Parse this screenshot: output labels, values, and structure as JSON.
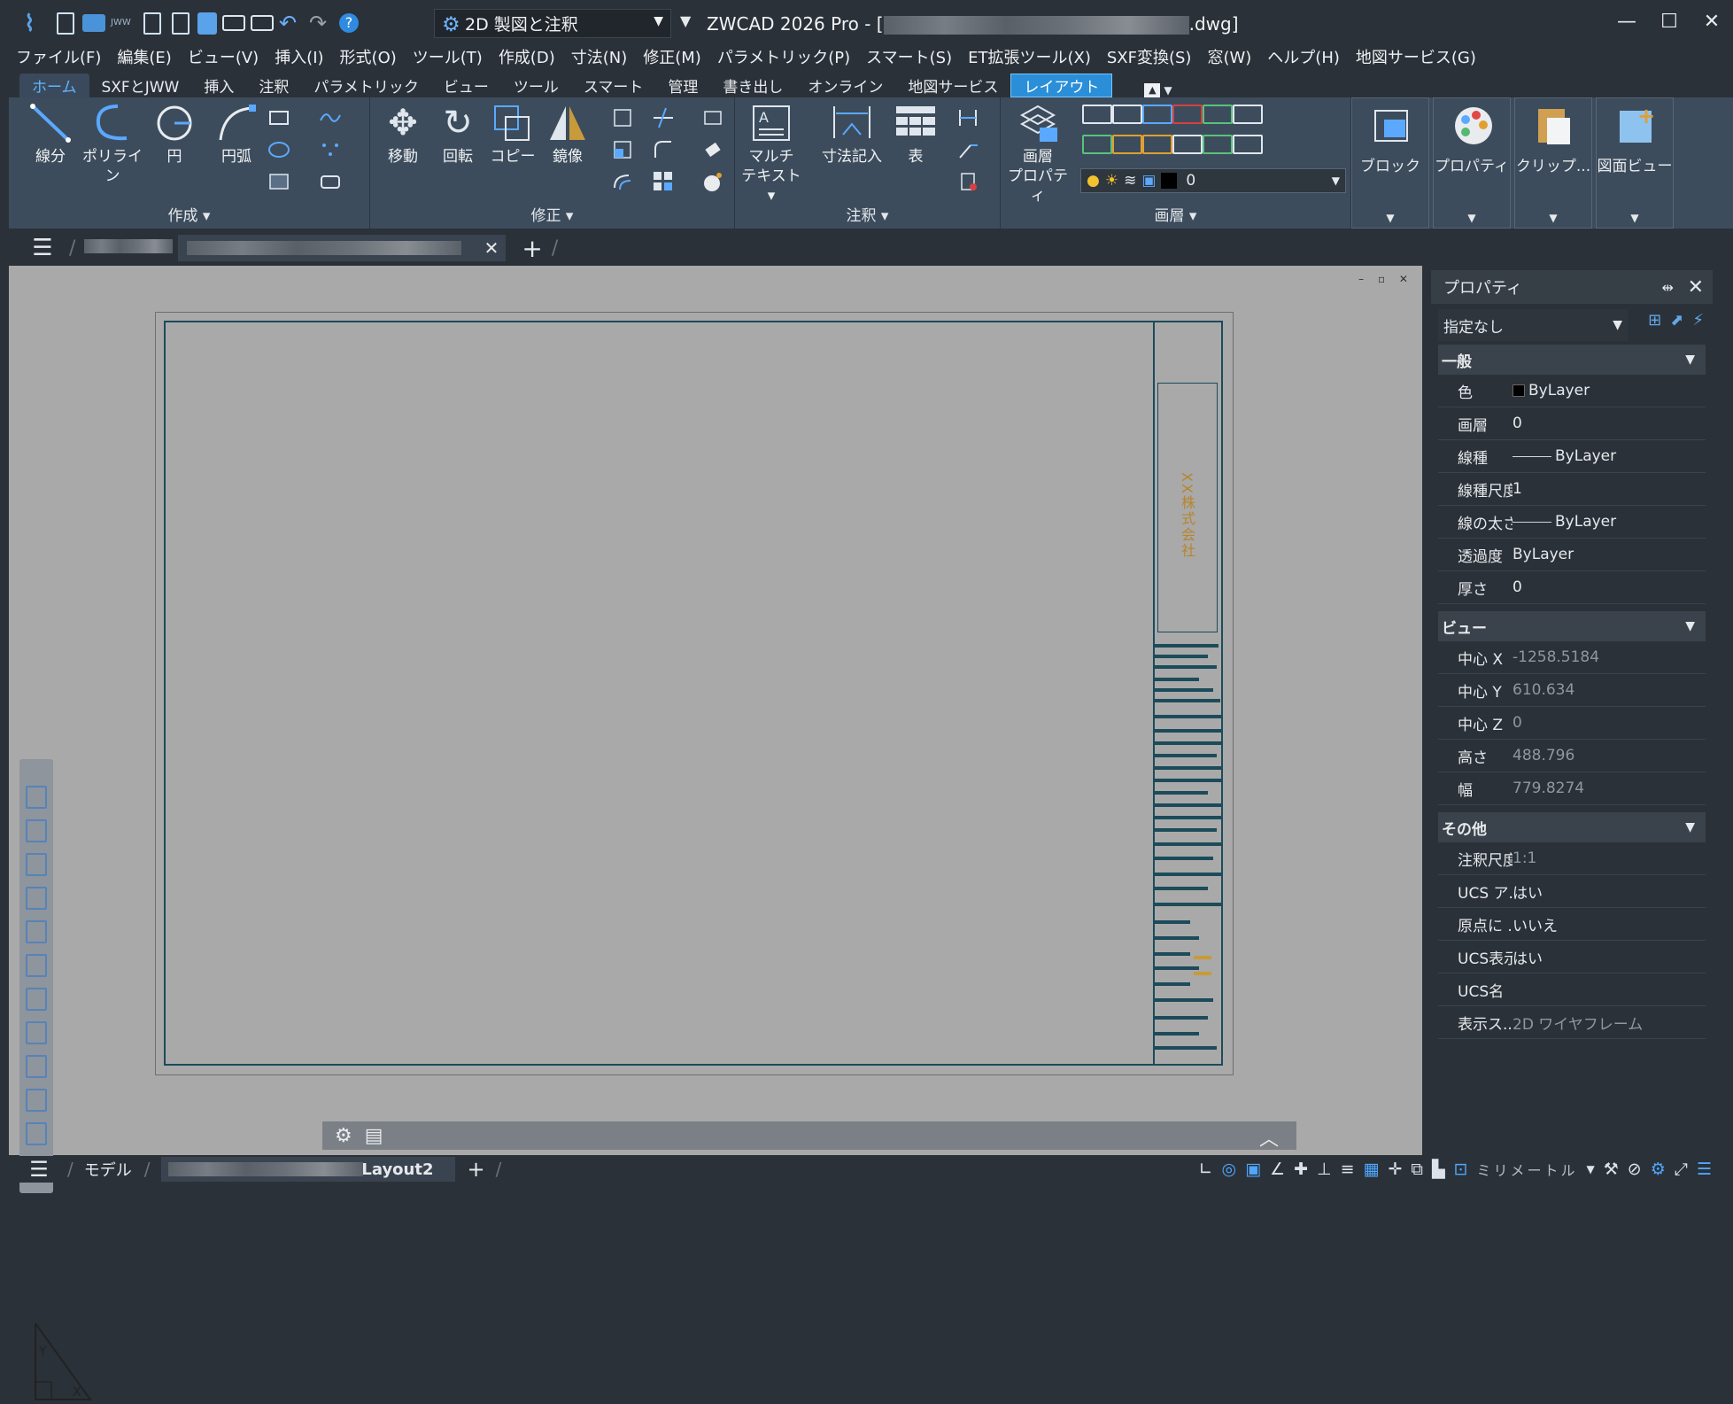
{
  "titlebar": {
    "workspace": "2D 製図と注釈",
    "app_name_prefix": "ZWCAD 2026 Pro - [",
    "file_suffix": ".dwg]",
    "win_min": "—",
    "win_max": "☐",
    "win_close": "✕"
  },
  "menu": [
    "ファイル(F)",
    "編集(E)",
    "ビュー(V)",
    "挿入(I)",
    "形式(O)",
    "ツール(T)",
    "作成(D)",
    "寸法(N)",
    "修正(M)",
    "パラメトリック(P)",
    "スマート(S)",
    "ET拡張ツール(X)",
    "SXF変換(S)",
    "窓(W)",
    "ヘルプ(H)",
    "地図サービス(G)"
  ],
  "tabs": [
    "ホーム",
    "SXFとJWW",
    "挿入",
    "注釈",
    "パラメトリック",
    "ビュー",
    "ツール",
    "スマート",
    "管理",
    "書き出し",
    "オンライン",
    "地図サービス",
    "レイアウト"
  ],
  "ribbon": {
    "create": {
      "label": "作成",
      "line": "線分",
      "polyline": "ポリライン",
      "circle": "円",
      "arc": "円弧"
    },
    "modify": {
      "label": "修正",
      "move": "移動",
      "rotate": "回転",
      "copy": "コピー",
      "mirror": "鏡像"
    },
    "annot": {
      "label": "注釈",
      "mtext1": "マルチ",
      "mtext2": "テキスト",
      "dim": "寸法記入",
      "table": "表"
    },
    "layer": {
      "label": "画層",
      "prop1": "画層",
      "prop2": "プロパティ",
      "current": "0"
    },
    "block": "ブロック",
    "properties": "プロパティ",
    "clipboard": "クリップ...",
    "viewsheet": "図面ビュー"
  },
  "canvas": {
    "company": "XX株式会社",
    "vpctrl": "– ▫ ✕"
  },
  "props": {
    "title": "プロパティ",
    "selection": "指定なし",
    "general": {
      "header": "一般",
      "rows": [
        {
          "k": "色",
          "v": "ByLayer"
        },
        {
          "k": "画層",
          "v": "0"
        },
        {
          "k": "線種",
          "v": "ByLayer"
        },
        {
          "k": "線種尺度",
          "v": "1"
        },
        {
          "k": "線の太さ",
          "v": "ByLayer"
        },
        {
          "k": "透過度",
          "v": "ByLayer"
        },
        {
          "k": "厚さ",
          "v": "0"
        }
      ]
    },
    "view": {
      "header": "ビュー",
      "rows": [
        {
          "k": "中心 X",
          "v": "-1258.5184"
        },
        {
          "k": "中心 Y",
          "v": "610.634"
        },
        {
          "k": "中心 Z",
          "v": "0"
        },
        {
          "k": "高さ",
          "v": "488.796"
        },
        {
          "k": "幅",
          "v": "779.8274"
        }
      ]
    },
    "other": {
      "header": "その他",
      "rows": [
        {
          "k": "注釈尺度",
          "v": "1:1"
        },
        {
          "k": "UCS ア...",
          "v": "はい"
        },
        {
          "k": "原点に ...",
          "v": "いいえ"
        },
        {
          "k": "UCS表示",
          "v": "はい"
        },
        {
          "k": "UCS名",
          "v": ""
        },
        {
          "k": "表示ス...",
          "v": "2D ワイヤフレーム"
        }
      ]
    }
  },
  "status": {
    "model": "モデル",
    "layout": "Layout2",
    "unit": "ミリメートル"
  },
  "colors": {
    "accent": "#2a8fd8",
    "canvas": "#a9a9a9",
    "frame": "#1c4b5a",
    "company": "#b7852c"
  }
}
